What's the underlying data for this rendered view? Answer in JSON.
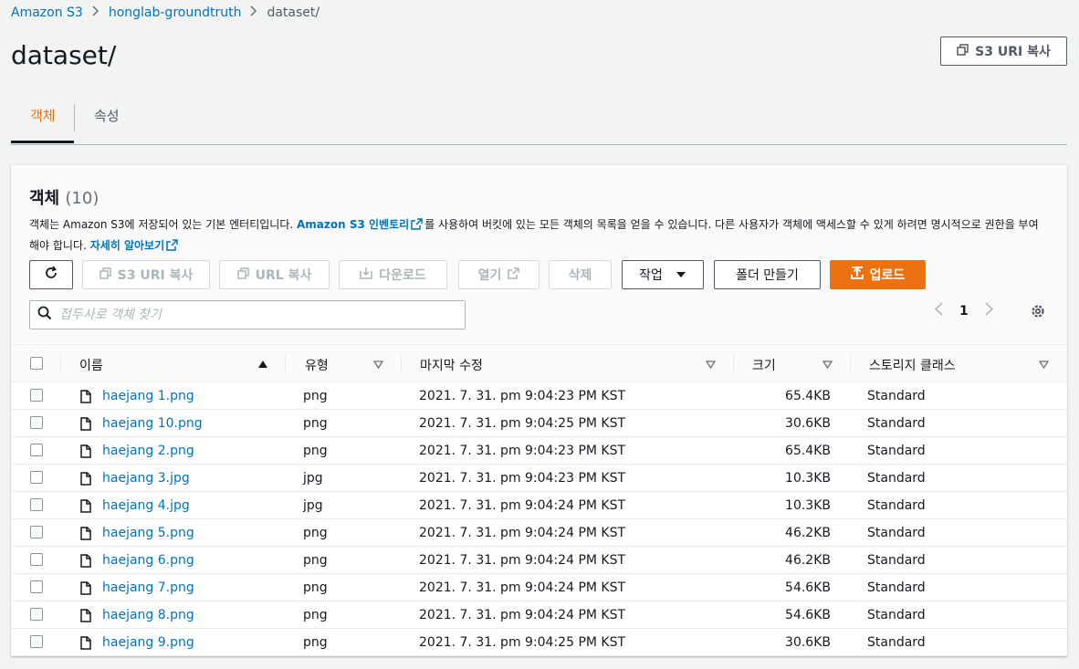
{
  "breadcrumb": {
    "items": [
      "Amazon S3",
      "honglab-groundtruth"
    ],
    "current": "dataset/"
  },
  "page_title": "dataset/",
  "copy_uri_label": "S3 URI 복사",
  "tabs": [
    {
      "label": "객체",
      "active": true
    },
    {
      "label": "속성",
      "active": false
    }
  ],
  "panel": {
    "title": "객체",
    "count": "(10)",
    "desc_part1": "객체는 Amazon S3에 저장되어 있는 기본 엔터티입니다. ",
    "desc_link1": "Amazon S3 인벤토리",
    "desc_part2": "를 사용하여 버킷에 있는 모든 객체의 목록을 얻을 수 있습니다. 다른 사용자가 객체에 액세스할 수 있게 하려면 명시적으로 권한을 부여해야 합니다. ",
    "desc_link2": "자세히 알아보기"
  },
  "toolbar": {
    "copy_s3_uri": "S3 URI 복사",
    "copy_url": "URL 복사",
    "download": "다운로드",
    "open": "열기",
    "delete": "삭제",
    "actions": "작업",
    "create_folder": "폴더 만들기",
    "upload": "업로드"
  },
  "search": {
    "placeholder": "접두사로 객체 찾기"
  },
  "pagination": {
    "current": "1"
  },
  "columns": {
    "name": "이름",
    "type": "유형",
    "modified": "마지막 수정",
    "size": "크기",
    "storage_class": "스토리지 클래스"
  },
  "rows": [
    {
      "name": "haejang 1.png",
      "type": "png",
      "modified": "2021. 7. 31. pm 9:04:23 PM KST",
      "size": "65.4KB",
      "storage_class": "Standard"
    },
    {
      "name": "haejang 10.png",
      "type": "png",
      "modified": "2021. 7. 31. pm 9:04:25 PM KST",
      "size": "30.6KB",
      "storage_class": "Standard"
    },
    {
      "name": "haejang 2.png",
      "type": "png",
      "modified": "2021. 7. 31. pm 9:04:23 PM KST",
      "size": "65.4KB",
      "storage_class": "Standard"
    },
    {
      "name": "haejang 3.jpg",
      "type": "jpg",
      "modified": "2021. 7. 31. pm 9:04:23 PM KST",
      "size": "10.3KB",
      "storage_class": "Standard"
    },
    {
      "name": "haejang 4.jpg",
      "type": "jpg",
      "modified": "2021. 7. 31. pm 9:04:24 PM KST",
      "size": "10.3KB",
      "storage_class": "Standard"
    },
    {
      "name": "haejang 5.png",
      "type": "png",
      "modified": "2021. 7. 31. pm 9:04:24 PM KST",
      "size": "46.2KB",
      "storage_class": "Standard"
    },
    {
      "name": "haejang 6.png",
      "type": "png",
      "modified": "2021. 7. 31. pm 9:04:24 PM KST",
      "size": "46.2KB",
      "storage_class": "Standard"
    },
    {
      "name": "haejang 7.png",
      "type": "png",
      "modified": "2021. 7. 31. pm 9:04:24 PM KST",
      "size": "54.6KB",
      "storage_class": "Standard"
    },
    {
      "name": "haejang 8.png",
      "type": "png",
      "modified": "2021. 7. 31. pm 9:04:24 PM KST",
      "size": "54.6KB",
      "storage_class": "Standard"
    },
    {
      "name": "haejang 9.png",
      "type": "png",
      "modified": "2021. 7. 31. pm 9:04:25 PM KST",
      "size": "30.6KB",
      "storage_class": "Standard"
    }
  ],
  "colors": {
    "accent": "#ec7211",
    "link": "#0073bb"
  }
}
